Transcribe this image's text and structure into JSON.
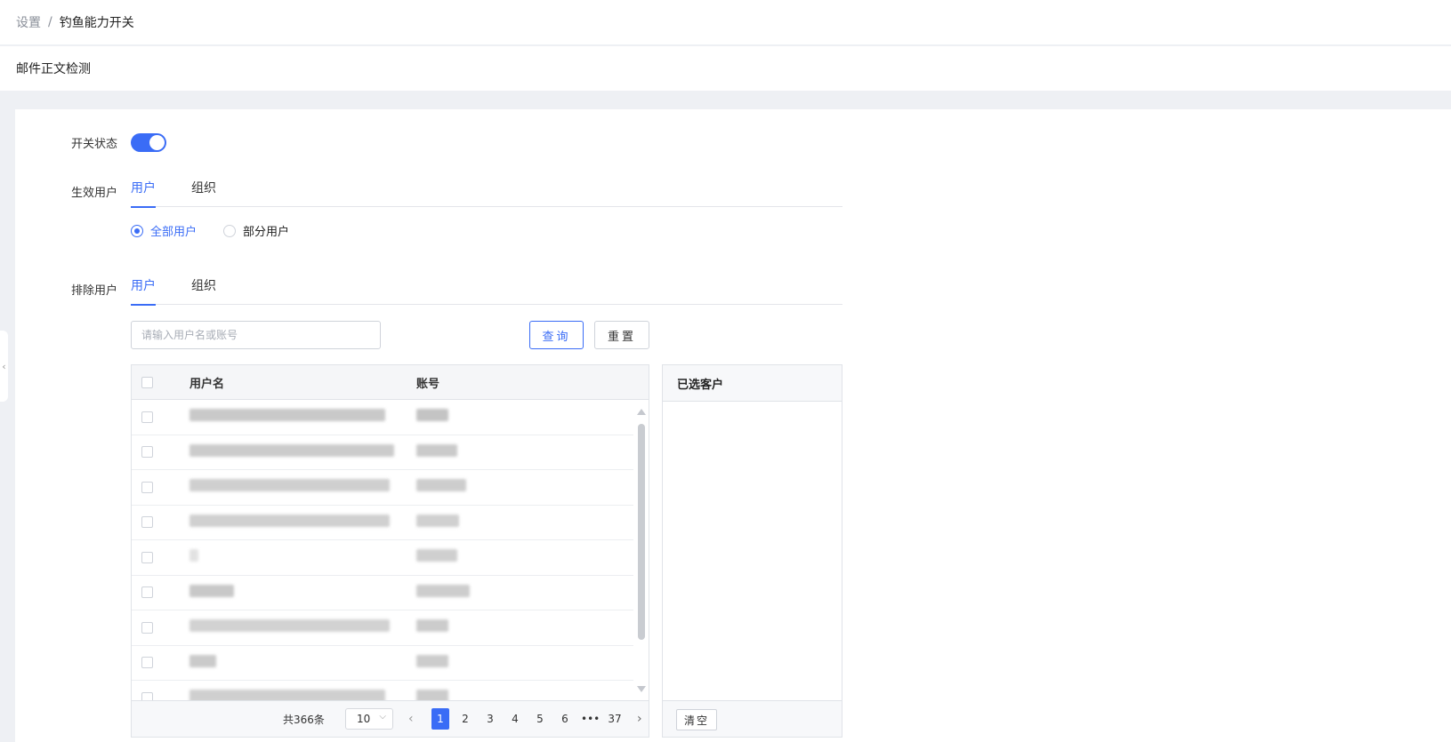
{
  "breadcrumb": {
    "parent": "设置",
    "separator": "/",
    "current": "钓鱼能力开关"
  },
  "page_header": {
    "title": "邮件正文检测"
  },
  "form": {
    "switch_label": "开关状态",
    "switch_on": true,
    "effective_users_label": "生效用户",
    "effective_tabs": [
      {
        "label": "用户",
        "active": true
      },
      {
        "label": "组织",
        "active": false
      }
    ],
    "radio_options": [
      {
        "label": "全部用户",
        "checked": true
      },
      {
        "label": "部分用户",
        "checked": false
      }
    ],
    "excluded_users_label": "排除用户",
    "excluded_tabs": [
      {
        "label": "用户",
        "active": true
      },
      {
        "label": "组织",
        "active": false
      }
    ]
  },
  "search": {
    "placeholder": "请输入用户名或账号",
    "value": ""
  },
  "buttons": {
    "query": "查询",
    "reset": "重置",
    "clear": "清空"
  },
  "table": {
    "columns": [
      "用户名",
      "账号"
    ],
    "rows": [
      {
        "name": "",
        "account": ""
      },
      {
        "name": "",
        "account": ""
      },
      {
        "name": "",
        "account": ""
      },
      {
        "name": "",
        "account": ""
      },
      {
        "name": "",
        "account": ""
      },
      {
        "name": "",
        "account": ""
      },
      {
        "name": "",
        "account": ""
      },
      {
        "name": "",
        "account": ""
      },
      {
        "name": "",
        "account": ""
      }
    ]
  },
  "pagination": {
    "total": "共366条",
    "page_size": "10",
    "pages": [
      "1",
      "2",
      "3",
      "4",
      "5",
      "6",
      "•••",
      "37"
    ],
    "current": "1"
  },
  "selected_panel": {
    "title": "已选客户"
  },
  "colors": {
    "accent": "#3a6cf6",
    "background": "#eef0f4"
  },
  "icons": {
    "prev": "chevron-left-icon",
    "next": "chevron-right-icon",
    "collapse": "chevron-left-icon"
  }
}
